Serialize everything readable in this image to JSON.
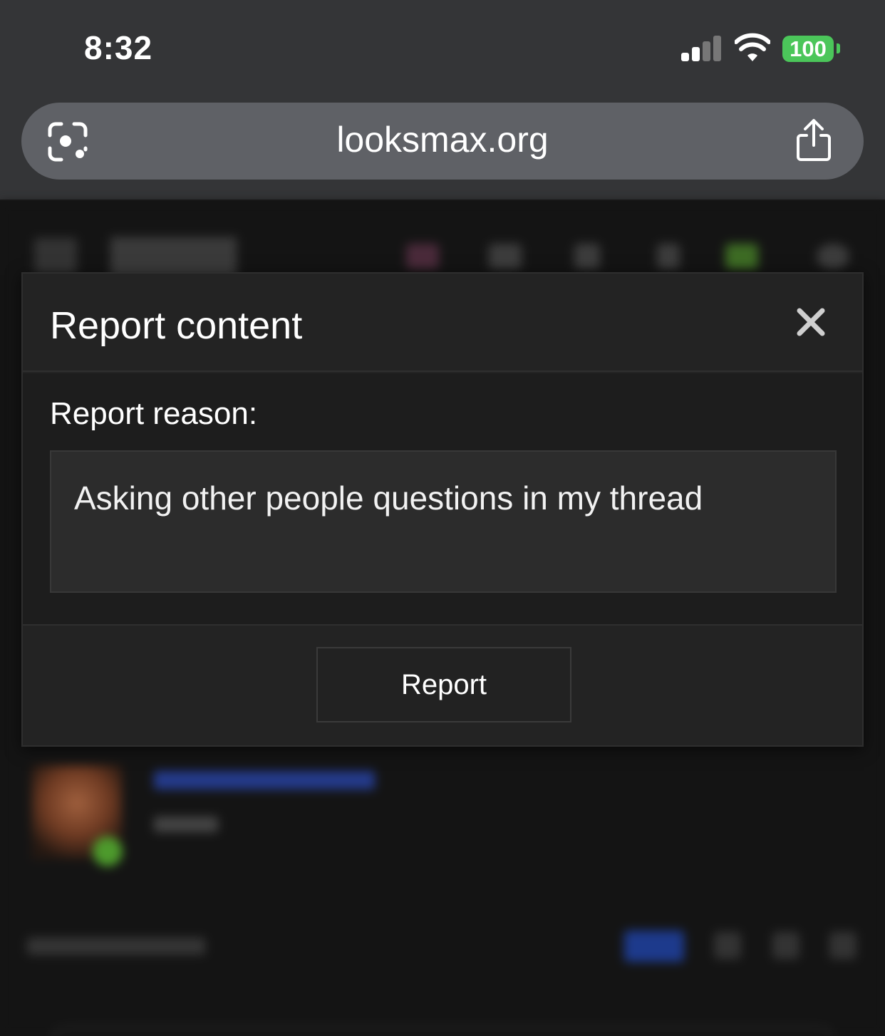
{
  "status_bar": {
    "time": "8:32",
    "battery": "100"
  },
  "browser": {
    "url": "looksmax.org"
  },
  "modal": {
    "title": "Report content",
    "reason_label": "Report reason:",
    "reason_value": "Asking other people questions in my thread",
    "submit_label": "Report"
  },
  "colors": {
    "chrome_bg": "#343537",
    "urlbar_bg": "#5f6166",
    "battery": "#4bc65a",
    "modal_bg": "#232323",
    "modal_body_bg": "#1d1d1d",
    "input_bg": "#2c2c2c"
  }
}
